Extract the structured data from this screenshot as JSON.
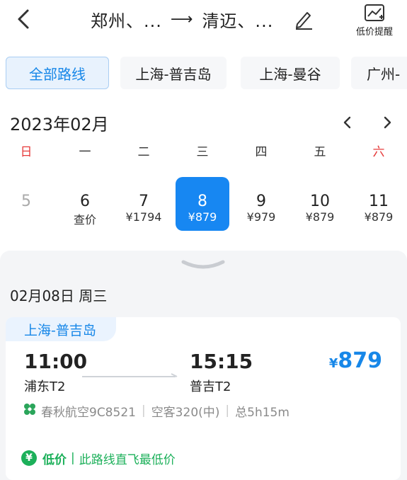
{
  "header": {
    "origin": "郑州、...",
    "arrow": "⟶",
    "destination": "清迈、...",
    "low_price_alert": "低价提醒"
  },
  "route_tabs": [
    {
      "label": "全部路线",
      "active": true
    },
    {
      "label": "上海-普吉岛",
      "active": false
    },
    {
      "label": "上海-曼谷",
      "active": false
    },
    {
      "label": "广州-",
      "active": false
    }
  ],
  "calendar": {
    "month": "2023年02月",
    "weekdays": [
      "日",
      "一",
      "二",
      "三",
      "四",
      "五",
      "六"
    ],
    "dates": [
      {
        "day": "5",
        "price": ""
      },
      {
        "day": "6",
        "price": "查价"
      },
      {
        "day": "7",
        "price": "¥1794"
      },
      {
        "day": "8",
        "price": "¥879"
      },
      {
        "day": "9",
        "price": "¥979"
      },
      {
        "day": "10",
        "price": "¥879"
      },
      {
        "day": "11",
        "price": "¥879"
      }
    ],
    "selected_index": 3
  },
  "selected_day": {
    "title": "02月08日 周三"
  },
  "flight": {
    "route": "上海-普吉岛",
    "dep_time": "11:00",
    "dep_airport": "浦东T2",
    "arr_time": "15:15",
    "arr_airport": "普吉T2",
    "price_symbol": "¥",
    "price": "879",
    "airline": "春秋航空9C8521",
    "aircraft": "空客320(中)",
    "duration": "总5h15m",
    "badge_icon": "¥",
    "badge_label": "低价",
    "badge_text": "此路线直飞最低价"
  },
  "colors": {
    "accent": "#1787f2",
    "sunday_saturday": "#e63a3a",
    "low_price_green": "#1cb05a"
  }
}
